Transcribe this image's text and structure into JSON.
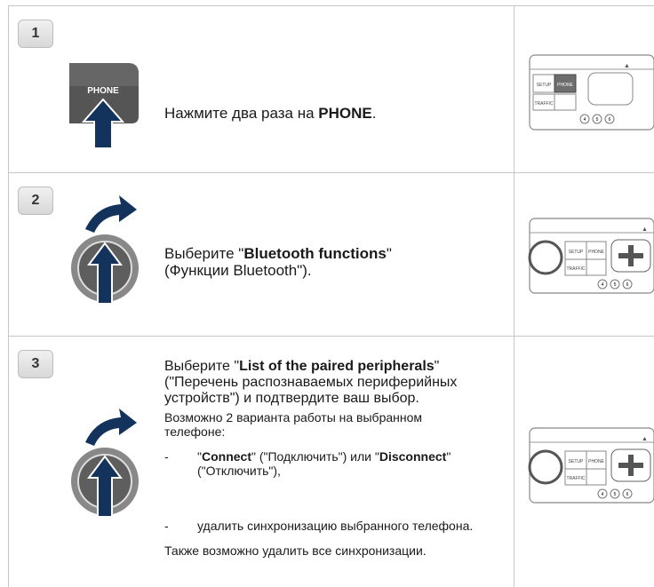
{
  "steps": [
    {
      "number": "1",
      "icon": "phone-button-icon",
      "button_label": "PHONE",
      "text_pre": "Нажмите два раза на ",
      "text_bold": "PHONE",
      "text_post": "."
    },
    {
      "number": "2",
      "icon": "rotary-knob-icon",
      "text_pre": "Выберите \"",
      "text_bold": "Bluetooth functions",
      "text_post": "\"",
      "text_line2": "(Функции Bluetooth\")."
    },
    {
      "number": "3",
      "icon": "rotary-knob-icon",
      "text_pre": "Выберите \"",
      "text_bold": "List of the paired peripherals",
      "text_post": "\"",
      "text_line2": "(\"Перечень распознаваемых периферийных",
      "text_line3": "устройств\") и подтвердите ваш выбор.",
      "sub_intro_1": "Возможно 2 варианта работы на выбранном",
      "sub_intro_2": "телефоне:",
      "bullet1_q1": "\"",
      "bullet1_b1": "Connect",
      "bullet1_m": "\" (\"Подключить\") или \"",
      "bullet1_b2": "Disconnect",
      "bullet1_q2": "\"",
      "bullet1_line2": "(\"Отключить\"),",
      "bullet2": "удалить синхронизацию выбранного телефона.",
      "dash": "-",
      "footer": "Также возможно удалить все синхронизации."
    }
  ],
  "device": {
    "setup": "SETUP",
    "phone": "PHONE",
    "traffic": "TRAFFIC",
    "presets": [
      "4",
      "5",
      "6"
    ]
  },
  "colors": {
    "arrow": "#14335c",
    "grid": "#c7c7c7"
  }
}
